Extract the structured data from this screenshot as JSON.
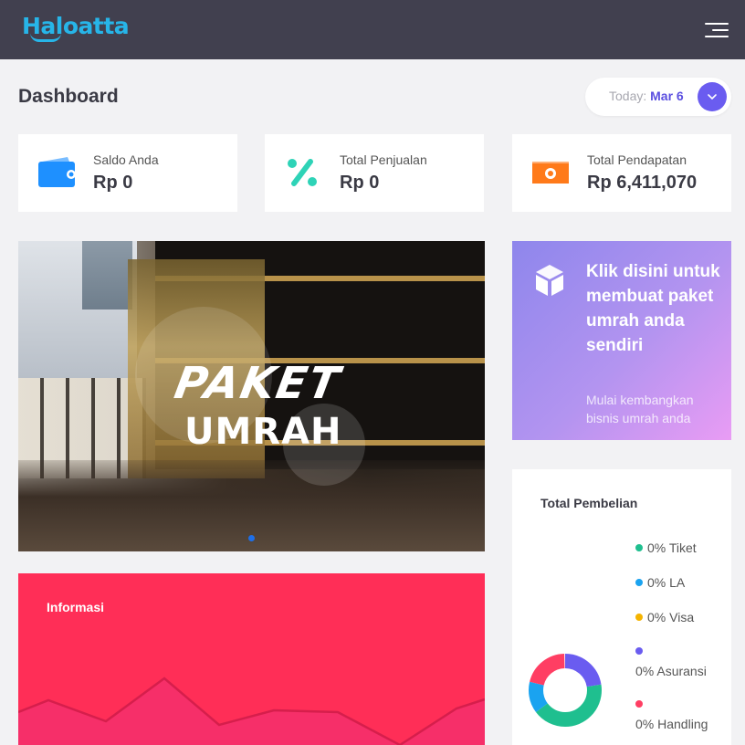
{
  "app": {
    "logo": "Haloatta"
  },
  "header": {
    "menu_icon": "hamburger-menu-icon"
  },
  "page": {
    "title": "Dashboard",
    "date_label": "Today:",
    "date_value": "Mar 6"
  },
  "stats": [
    {
      "label": "Saldo Anda",
      "value": "Rp 0",
      "icon": "wallet-icon",
      "color": "#1e90ff"
    },
    {
      "label": "Total Penjualan",
      "value": "Rp 0",
      "icon": "percent-icon",
      "color": "#2ed3b7"
    },
    {
      "label": "Total Pendapatan",
      "value": "Rp 6,411,070",
      "icon": "cash-icon",
      "color": "#ff7a1a"
    }
  ],
  "banner": {
    "line1": "PAKET",
    "line2": "UMRAH"
  },
  "promo": {
    "title": "Klik disini untuk membuat paket umrah anda sendiri",
    "subtitle": "Mulai kembangkan bisnis umrah anda",
    "icon": "box-icon"
  },
  "info": {
    "title": "Informasi",
    "color": "#ff2e57"
  },
  "purchase": {
    "title": "Total Pembelian",
    "legend": [
      {
        "label": "0% Tiket",
        "color": "#1fbf8f"
      },
      {
        "label": "0% LA",
        "color": "#1aa3f0"
      },
      {
        "label": "0% Visa",
        "color": "#f5b400"
      },
      {
        "label": "0% Asuransi",
        "color": "#6a5cf0"
      },
      {
        "label": "0% Handling",
        "color": "#ff3e63"
      }
    ]
  },
  "colors": {
    "topbar": "#41404f",
    "accent": "#6a5cf0"
  }
}
